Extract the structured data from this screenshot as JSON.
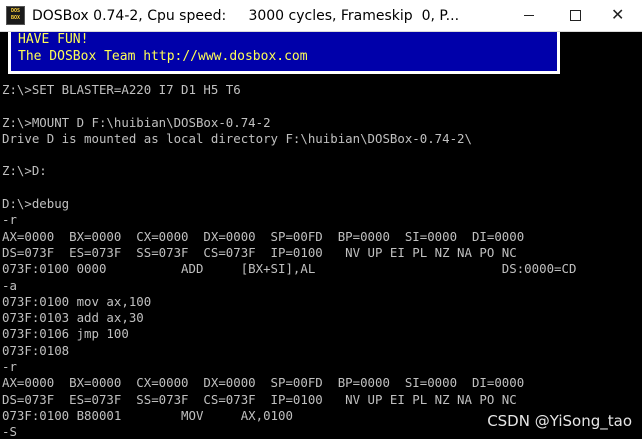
{
  "window": {
    "title": "DOSBox 0.74-2, Cpu speed:     3000 cycles, Frameskip  0, P...",
    "icon_label_top": "DOS",
    "icon_label_bottom": "BOX",
    "minimize_icon": "minimize-icon",
    "maximize_icon": "maximize-icon",
    "close_glyph": "✕"
  },
  "banner": {
    "line1": "HAVE FUN!",
    "line2": "The DOSBox Team http://www.dosbox.com",
    "bg_color": "#0000aa",
    "text_color": "#ffff55"
  },
  "console": {
    "lines": [
      "Z:\\>SET BLASTER=A220 I7 D1 H5 T6",
      "",
      "Z:\\>MOUNT D F:\\huibian\\DOSBox-0.74-2",
      "Drive D is mounted as local directory F:\\huibian\\DOSBox-0.74-2\\",
      "",
      "Z:\\>D:",
      "",
      "D:\\>debug",
      "-r",
      "AX=0000  BX=0000  CX=0000  DX=0000  SP=00FD  BP=0000  SI=0000  DI=0000",
      "DS=073F  ES=073F  SS=073F  CS=073F  IP=0100   NV UP EI PL NZ NA PO NC",
      "073F:0100 0000          ADD     [BX+SI],AL                         DS:0000=CD",
      "-a",
      "073F:0100 mov ax,100",
      "073F:0103 add ax,30",
      "073F:0106 jmp 100",
      "073F:0108",
      "-r",
      "AX=0000  BX=0000  CX=0000  DX=0000  SP=00FD  BP=0000  SI=0000  DI=0000",
      "DS=073F  ES=073F  SS=073F  CS=073F  IP=0100   NV UP EI PL NZ NA PO NC",
      "073F:0100 B80001        MOV     AX,0100",
      "-S"
    ]
  },
  "watermark": "CSDN @YiSong_tao"
}
